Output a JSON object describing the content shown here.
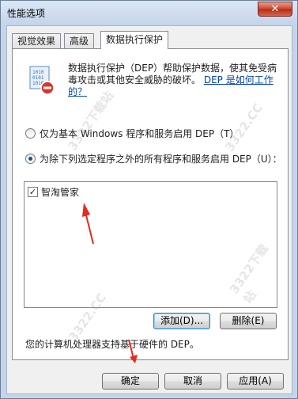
{
  "window": {
    "title": "性能选项",
    "close_glyph": "✕"
  },
  "tabs": [
    {
      "label": "视觉效果"
    },
    {
      "label": "高级"
    },
    {
      "label": "数据执行保护"
    }
  ],
  "panel": {
    "description": "数据执行保护（DEP）帮助保护数据，使其免受病毒攻击或其他安全威胁的破坏。",
    "link": "DEP 是如何工作的？",
    "options": [
      {
        "label": "仅为基本 Windows 程序和服务启用 DEP（T）",
        "selected": false
      },
      {
        "label": "为除下列选定程序之外的所有程序和服务启用 DEP（U）：",
        "selected": true
      }
    ],
    "exceptions": [
      {
        "label": "智淘管家",
        "checked": true
      }
    ],
    "add_button": "添加(D)...",
    "remove_button": "删除(E)",
    "hardware_note": "您的计算机处理器支持基于硬件的 DEP。"
  },
  "footer": {
    "ok_button": "确定",
    "cancel_button": "取消",
    "apply_button": "应用(A)"
  },
  "watermarks": [
    "3322下载站",
    "3322.CC",
    "3322下载站",
    "3322.CC"
  ],
  "colors": {
    "arrow": "#e8291c",
    "link": "#0645ad"
  }
}
